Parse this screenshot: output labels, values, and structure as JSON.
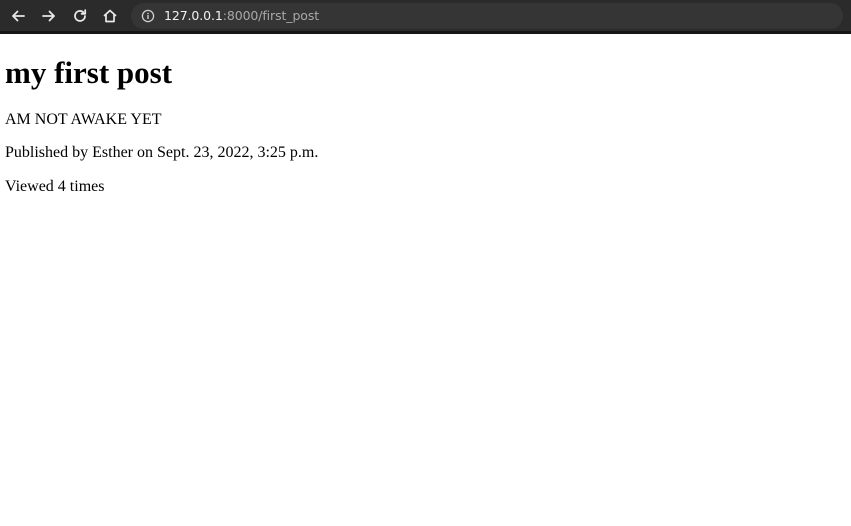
{
  "browser": {
    "url_host": "127.0.0.1",
    "url_path": ":8000/first_post",
    "icons": [
      "arrow-back-icon",
      "arrow-forward-icon",
      "reload-icon",
      "home-icon",
      "info-icon"
    ]
  },
  "post": {
    "title": "my first post",
    "body": "AM NOT AWAKE YET",
    "meta": "Published by Esther on Sept. 23, 2022, 3:25 p.m.",
    "views": "Viewed 4 times"
  },
  "colors": {
    "toolbar": "#2b2b2b",
    "omnibox": "#353535",
    "page_background": "#ffffff",
    "text": "#000000"
  }
}
